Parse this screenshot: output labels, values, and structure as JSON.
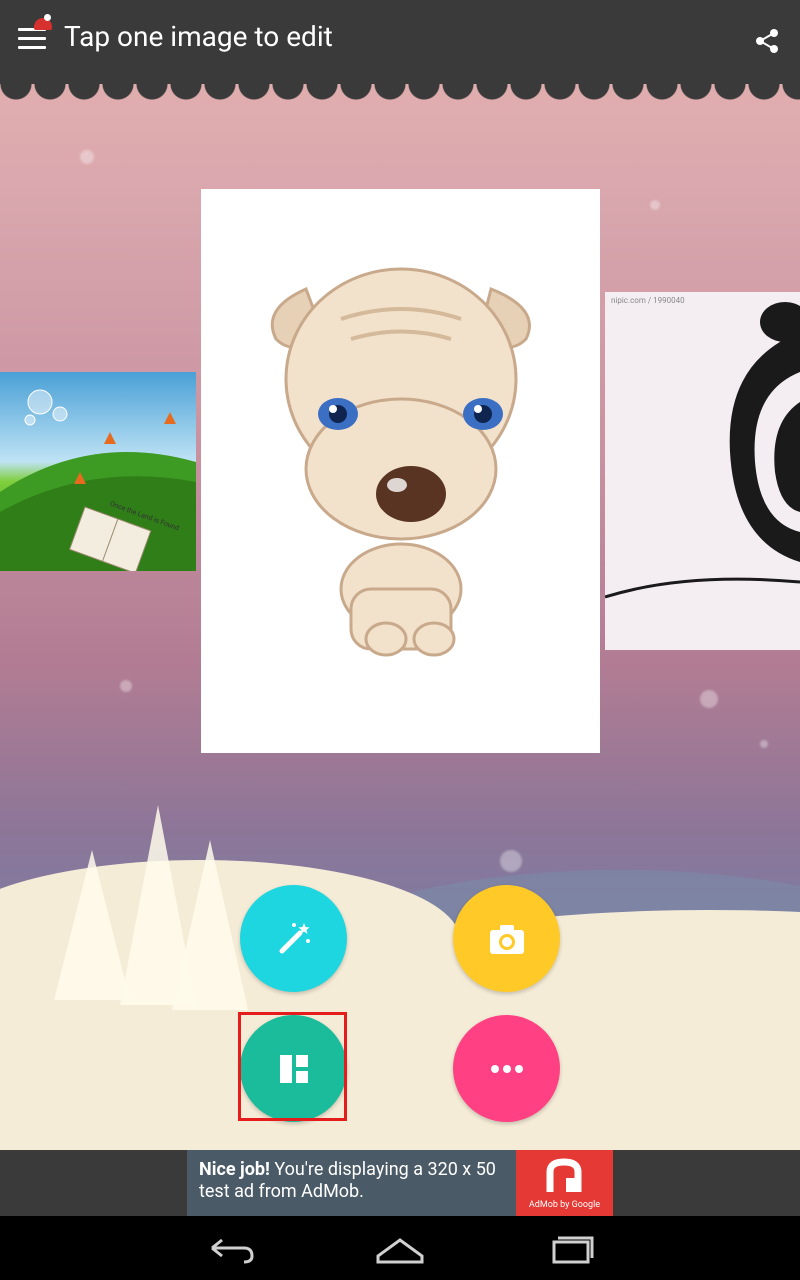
{
  "app_bar": {
    "title": "Tap one image to edit",
    "menu_icon": "hamburger-menu-icon",
    "share_icon": "share-icon"
  },
  "images": {
    "main": "puppy-illustration",
    "left": "grass-book-photo",
    "right": "panda-illustration"
  },
  "right_photo_caption": "nipic.com / 1990040",
  "left_photo_text": "Once the Land is Found",
  "fabs": [
    {
      "name": "magic-wand",
      "color": "#1ed6e0"
    },
    {
      "name": "camera",
      "color": "#ffc927"
    },
    {
      "name": "layout",
      "color": "#1bbc9b"
    },
    {
      "name": "more",
      "color": "#ff4082"
    }
  ],
  "ad": {
    "headline": "Nice job!",
    "body": " You're displaying a 320 x 50 test ad from AdMob.",
    "logo_caption": "AdMob by Google"
  },
  "navigation": {
    "back": "back-icon",
    "home": "home-icon",
    "recents": "recent-apps-icon"
  }
}
